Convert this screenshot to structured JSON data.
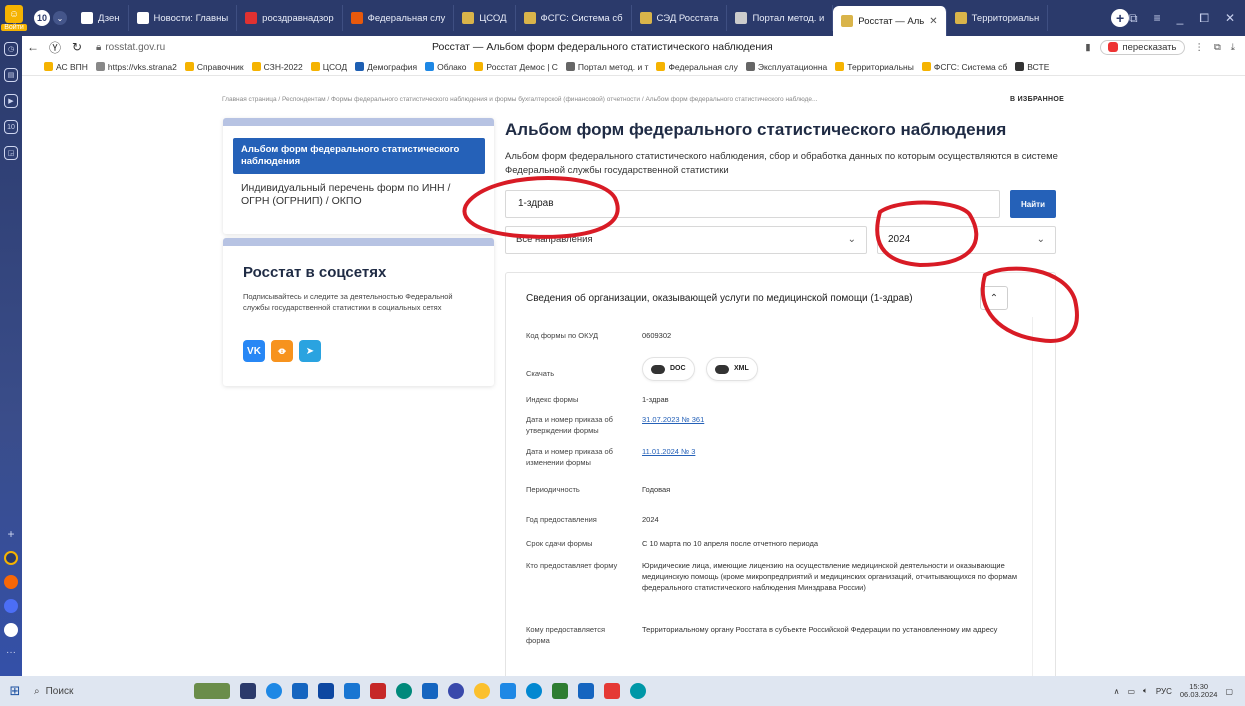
{
  "browser": {
    "logo_label": "Войти",
    "tab_counter": "10",
    "tabs": [
      {
        "label": "Дзен",
        "color": "#ffffff"
      },
      {
        "label": "Новости: Главны",
        "color": "#ffffff"
      },
      {
        "label": "росздравнадзор",
        "color": "#e03131"
      },
      {
        "label": "Федеральная слу",
        "color": "#e8590c"
      },
      {
        "label": "ЦСОД",
        "color": "#d9b44a"
      },
      {
        "label": "ФСГС: Система сб",
        "color": "#d9b44a"
      },
      {
        "label": "СЭД Росстата",
        "color": "#d9b44a"
      },
      {
        "label": "Портал метод. и",
        "color": "#cccccc"
      },
      {
        "label": "Росстат — Аль",
        "color": "#d9b44a",
        "active": true
      },
      {
        "label": "Территориальн",
        "color": "#d9b44a"
      }
    ],
    "url": "rosstat.gov.ru",
    "page_title": "Росстат — Альбом форм федерального статистического наблюдения",
    "retell_label": "пересказать",
    "bookmarks": [
      "АС ВПН",
      "https://vks.strana2",
      "Справочник",
      "СЗН-2022",
      "ЦСОД",
      "Демография",
      "Облако",
      "Росстат Демос | С",
      "Портал метод. и т",
      "Федеральная слу",
      "Эксплуатационна",
      "Территориальны",
      "ФСГС: Система сб",
      "ВСТЕ"
    ]
  },
  "page": {
    "breadcrumb": "Главная страница / Респондентам / Формы федерального статистического наблюдения и формы бухгалтерской (финансовой) отчетности / Альбом форм федерального статистического наблюде...",
    "favorite_label": "В ИЗБРАННОЕ",
    "left_nav": {
      "active": "Альбом форм федерального статистического наблюдения",
      "item": "Индивидуальный перечень форм по ИНН / ОГРН (ОГРНИП) / ОКПО"
    },
    "social": {
      "title": "Росстат в соцсетях",
      "text": "Подписывайтесь и следите за деятельностью Федеральной службы государственной статистики в социальных сетях"
    },
    "title": "Альбом форм федерального статистического наблюдения",
    "description": "Альбом форм федерального статистического наблюдения, сбор и обработка данных по которым осуществляются в системе Федеральной службы государственной статистики",
    "search_value": "1-здрав",
    "find_label": "Найти",
    "direction_select": "Все направления",
    "year_select": "2024",
    "card": {
      "title": "Сведения об организации, оказывающей услуги по медицинской помощи (1-здрав)",
      "okud_label": "Код формы по ОКУД",
      "okud_value": "0609302",
      "download_label": "Скачать",
      "doc_label": "DOC",
      "xml_label": "XML",
      "index_label": "Индекс формы",
      "index_value": "1-здрав",
      "approval_label": "Дата и номер приказа об утверждении формы",
      "approval_value": "31.07.2023 № 361",
      "change_label": "Дата и номер приказа об изменении формы",
      "change_value": "11.01.2024 № 3",
      "period_label": "Периодичность",
      "period_value": "Годовая",
      "year_label": "Год предоставления",
      "year_value": "2024",
      "deadline_label": "Срок сдачи формы",
      "deadline_value": "С 10 марта по 10 апреля после отчетного периода",
      "who_label": "Кто предоставляет форму",
      "who_value": "Юридические лица, имеющие лицензию на осуществление медицинской деятельности и оказывающие медицинскую помощь (кроме микропредприятий и медицинских организаций, отчитывающихся по формам федерального статистического наблюдения Минздрава России)",
      "to_whom_label": "Кому предоставляется форма",
      "to_whom_value": "Территориальному органу Росстата в субъекте Российской Федерации по установленному им адресу"
    }
  },
  "taskbar": {
    "search_label": "Поиск",
    "lang": "РУС",
    "time": "15:30",
    "date": "06.03.2024"
  },
  "colors": {
    "accent": "#2561b8",
    "annotation": "#d81b25"
  }
}
